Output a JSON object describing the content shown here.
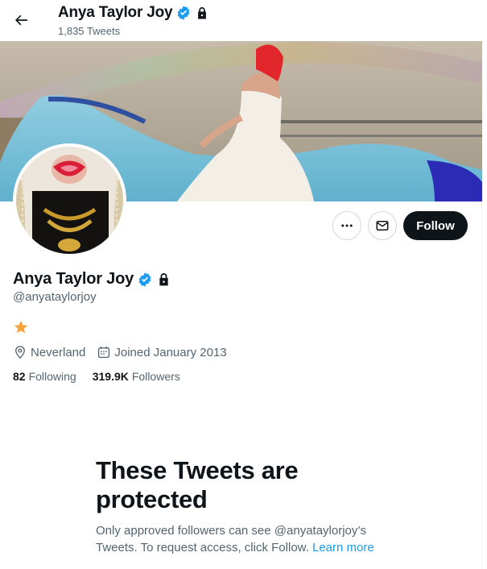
{
  "header": {
    "display_name": "Anya Taylor Joy",
    "tweet_count": "1,835 Tweets"
  },
  "profile": {
    "display_name": "Anya Taylor Joy",
    "handle": "@anyataylorjoy",
    "location": "Neverland",
    "joined": "Joined January 2013",
    "following_count": "82",
    "following_label": "Following",
    "followers_count": "319.9K",
    "followers_label": "Followers"
  },
  "actions": {
    "follow_label": "Follow"
  },
  "protected": {
    "title": "These Tweets are protected",
    "body": "Only approved followers can see @anyataylorjoy’s Tweets. To request access, click Follow. ",
    "learn_more": "Learn more"
  },
  "colors": {
    "verified": "#1d9bf0",
    "text_primary": "#0f1419",
    "text_secondary": "#536471",
    "star": "#f7a33c"
  },
  "icons": [
    "back-arrow-icon",
    "verified-badge-icon",
    "lock-icon",
    "more-icon",
    "mail-icon",
    "star-icon",
    "location-pin-icon",
    "calendar-icon"
  ]
}
